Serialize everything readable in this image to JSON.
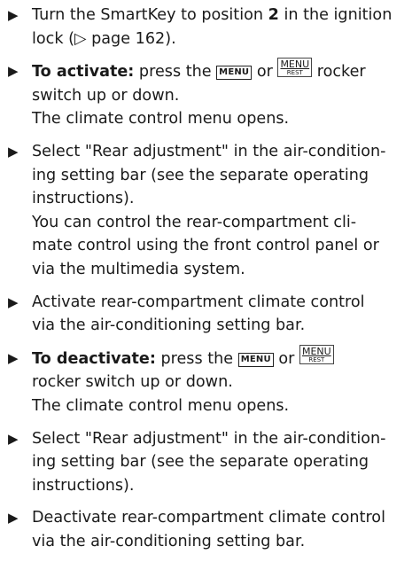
{
  "symbols": {
    "bullet": "▶",
    "page_ref_arrow": "▷"
  },
  "keys": {
    "menu": "MENU",
    "menu_rest_top": "MENU",
    "menu_rest_bottom": "REST"
  },
  "steps": [
    {
      "lines": [
        [
          "Turn the SmartKey to position ",
          "2",
          " in the ignition"
        ],
        [
          "lock (",
          "▷",
          " page 162)."
        ]
      ]
    },
    {
      "bold": "To activate:",
      "text1": " press the ",
      "text2": " or ",
      "text3": " rocker",
      "line2": "switch up or down.",
      "line3": "The climate control menu opens."
    },
    {
      "lines": [
        "Select \"Rear adjustment\" in the air-condition-",
        "ing setting bar (see the separate operating",
        "instructions).",
        "You can control the rear-compartment cli-",
        "mate control using the front control panel or",
        "via the multimedia system."
      ]
    },
    {
      "lines": [
        "Activate rear-compartment climate control",
        "via the air-conditioning setting bar."
      ]
    },
    {
      "bold": "To deactivate:",
      "text1": " press the ",
      "text2": " or ",
      "line2": "rocker switch up or down.",
      "line3": "The climate control menu opens."
    },
    {
      "lines": [
        "Select \"Rear adjustment\" in the air-condition-",
        "ing setting bar (see the separate operating",
        "instructions)."
      ]
    },
    {
      "lines": [
        "Deactivate rear-compartment climate control",
        "via the air-conditioning setting bar."
      ]
    }
  ]
}
